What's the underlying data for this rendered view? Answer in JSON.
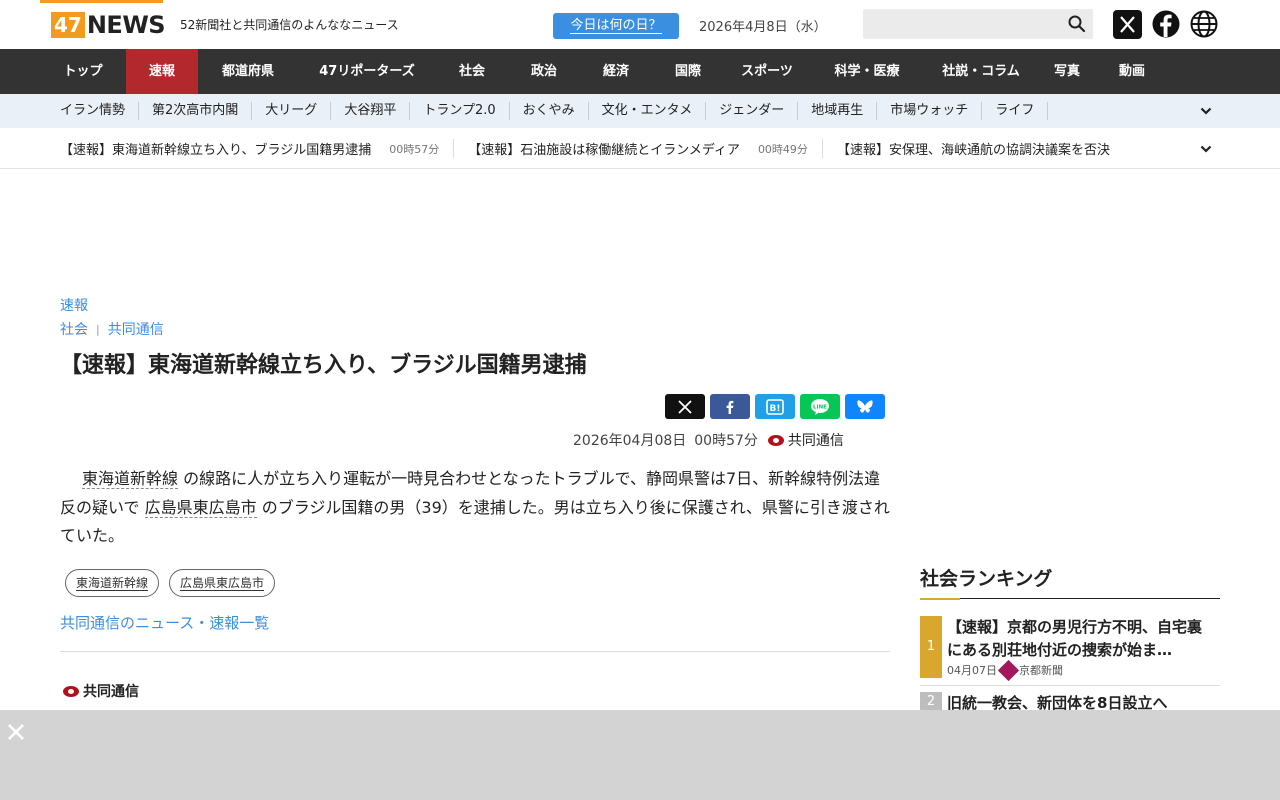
{
  "header": {
    "logo_number": "47",
    "logo_word": "NEWS",
    "tagline": "52新聞社と共同通信のよんななニュース",
    "today_button": "今日は何の日？",
    "date": "2026年4月8日（水）",
    "search_placeholder": "",
    "icons": [
      "search-icon",
      "x-icon",
      "facebook-icon",
      "globe-icon"
    ]
  },
  "nav": {
    "items": [
      "トップ",
      "速報",
      "都道府県",
      "47リポーターズ",
      "社会",
      "政治",
      "経済",
      "国際",
      "スポーツ",
      "科学・医療",
      "社説・コラム",
      "写真",
      "動画"
    ],
    "active": "速報",
    "active_color": "#b3282d",
    "bar_color": "#333333"
  },
  "subnav": {
    "items": [
      "イラン情勢",
      "第2次高市内閣",
      "大リーグ",
      "大谷翔平",
      "トランプ2.0",
      "おくやみ",
      "文化・エンタメ",
      "ジェンダー",
      "地域再生",
      "市場ウォッチ",
      "ライフ"
    ]
  },
  "ticker": {
    "items": [
      {
        "title": "【速報】東海道新幹線立ち入り、ブラジル国籍男逮捕",
        "time": "00時57分"
      },
      {
        "title": "【速報】石油施設は稼働継続とイランメディア",
        "time": "00時49分"
      },
      {
        "title": "【速報】安保理、海峡通航の協調決議案を否決",
        "time": ""
      }
    ]
  },
  "article": {
    "category": "速報",
    "subcategory": "社会",
    "source": "共同通信",
    "title": "【速報】東海道新幹線立ち入り、ブラジル国籍男逮捕",
    "date": "2026年04月08日",
    "time": "00時57分",
    "body": {
      "link1": "東海道新幹線",
      "part1": " の線路に人が立ち入り運転が一時見合わせとなったトラブルで、静岡県警は7日、新幹線特例法違反の疑いで ",
      "link2": "広島県東広島市",
      "part2": " のブラジル国籍の男（39）を逮捕した。男は立ち入り後に保護され、県警に引き渡されていた。"
    },
    "tags": [
      "東海道新幹線",
      "広島県東広島市"
    ],
    "list_link": "共同通信のニュース・速報一覧",
    "footer_source": "共同通信",
    "share_buttons": [
      {
        "name": "x-share-button",
        "label": "X",
        "color": "#111111"
      },
      {
        "name": "facebook-share-button",
        "label": "f",
        "color": "#3b5998"
      },
      {
        "name": "hatena-share-button",
        "label": "B!",
        "color": "#1fa0e8"
      },
      {
        "name": "line-share-button",
        "label": "LINE",
        "color": "#06c755"
      },
      {
        "name": "bluesky-share-button",
        "label": "bluesky",
        "color": "#1185fe"
      }
    ],
    "link_color": "#3a8fe0"
  },
  "ranking": {
    "title": "社会ランキング",
    "items": [
      {
        "rank": "1",
        "title": "【速報】京都の男児行方不明、自宅裏にある別荘地付近の捜索が始ま…",
        "date": "04月07日",
        "source": "京都新聞",
        "badge_color": "#d9a62e"
      },
      {
        "rank": "2",
        "title": "旧統一教会、新団体を8日設立へ",
        "date": "",
        "source": "",
        "badge_color": "#bdbdbd"
      }
    ]
  },
  "overlay": {
    "close_icon": "close-icon"
  }
}
